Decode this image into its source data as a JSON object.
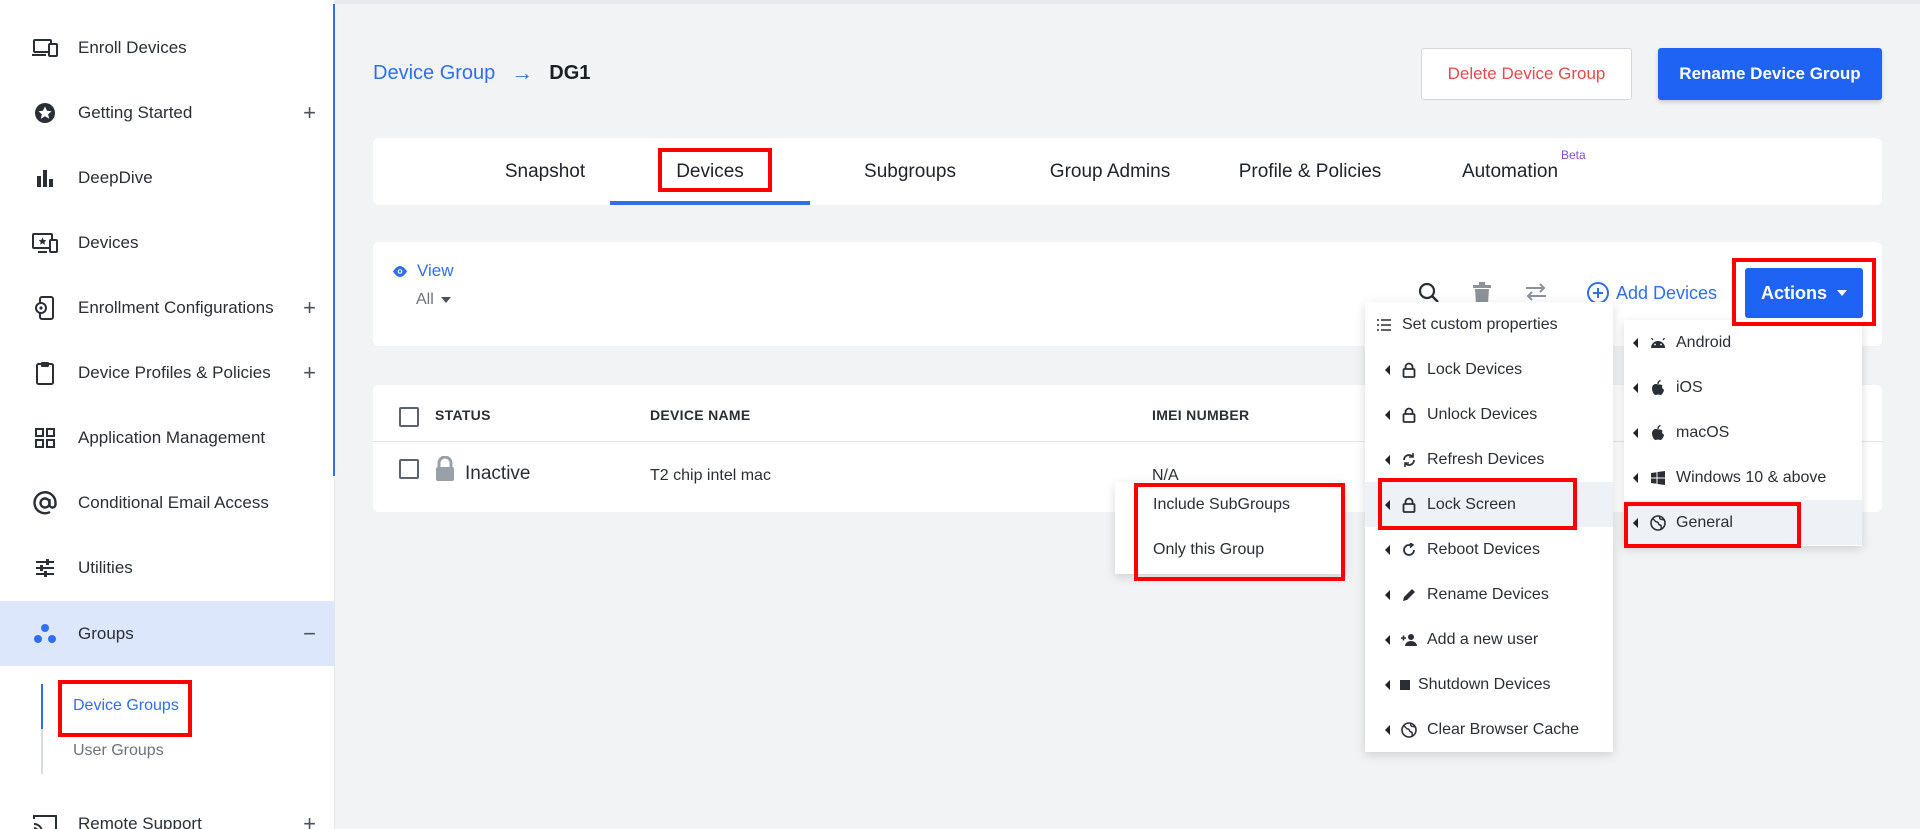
{
  "sidebar": {
    "items": [
      {
        "label": "Enroll Devices",
        "icon": "devices-icon",
        "plus": false
      },
      {
        "label": "Getting Started",
        "icon": "star-icon",
        "plus": true
      },
      {
        "label": "DeepDive",
        "icon": "bar-chart-icon",
        "plus": false
      },
      {
        "label": "Devices",
        "icon": "monitor-star-icon",
        "plus": false
      },
      {
        "label": "Enrollment Configurations",
        "icon": "phone-gear-icon",
        "plus": true
      },
      {
        "label": "Device Profiles & Policies",
        "icon": "clipboard-icon",
        "plus": true
      },
      {
        "label": "Application Management",
        "icon": "apps-grid-icon",
        "plus": false
      },
      {
        "label": "Conditional Email Access",
        "icon": "at-sign-icon",
        "plus": false
      },
      {
        "label": "Utilities",
        "icon": "sliders-icon",
        "plus": false
      },
      {
        "label": "Groups",
        "icon": "groups-icon",
        "minus": true
      },
      {
        "label": "Remote Support",
        "icon": "cast-icon",
        "plus": true
      }
    ],
    "sub_items": [
      "Device Groups",
      "User Groups"
    ],
    "plus_symbol": "+",
    "minus_symbol": "−"
  },
  "header": {
    "breadcrumb_root": "Device Group",
    "breadcrumb_arrow": "→",
    "breadcrumb_current": "DG1",
    "delete_label": "Delete Device Group",
    "rename_label": "Rename Device Group"
  },
  "tabs": {
    "items": [
      "Snapshot",
      "Devices",
      "Subgroups",
      "Group Admins",
      "Profile & Policies",
      "Automation"
    ],
    "active": "Devices",
    "beta_label": "Beta"
  },
  "toolbar": {
    "view_label": "View",
    "view_value": "All",
    "add_devices_label": "Add Devices",
    "actions_label": "Actions"
  },
  "table": {
    "columns": [
      "STATUS",
      "DEVICE NAME",
      "IMEI NUMBER"
    ],
    "rows": [
      {
        "status": "Inactive",
        "device_name": "T2 chip intel mac",
        "imei": "N/A"
      }
    ]
  },
  "actions_menu": {
    "items": [
      {
        "label": "Set custom properties",
        "icon": "list-icon",
        "sub": false
      },
      {
        "label": "Lock Devices",
        "icon": "lock-icon",
        "sub": true
      },
      {
        "label": "Unlock Devices",
        "icon": "lock-icon",
        "sub": true
      },
      {
        "label": "Refresh Devices",
        "icon": "refresh-icon",
        "sub": true
      },
      {
        "label": "Lock Screen",
        "icon": "lock-icon",
        "sub": true
      },
      {
        "label": "Reboot Devices",
        "icon": "reboot-icon",
        "sub": true
      },
      {
        "label": "Rename Devices",
        "icon": "pencil-icon",
        "sub": true
      },
      {
        "label": "Add a new user",
        "icon": "add-user-icon",
        "sub": true
      },
      {
        "label": "Shutdown Devices",
        "icon": "stop-icon",
        "sub": true
      },
      {
        "label": "Clear Browser Cache",
        "icon": "globe-icon",
        "sub": true
      }
    ]
  },
  "platform_menu": {
    "items": [
      {
        "label": "Android",
        "icon": "android-icon"
      },
      {
        "label": "iOS",
        "icon": "apple-icon"
      },
      {
        "label": "macOS",
        "icon": "apple-icon"
      },
      {
        "label": "Windows 10 & above",
        "icon": "windows-icon"
      },
      {
        "label": "General",
        "icon": "globe-icon"
      }
    ]
  },
  "scope_menu": {
    "items": [
      "Include SubGroups",
      "Only this Group"
    ]
  },
  "colors": {
    "primary": "#1f63f5",
    "danger": "#e24c4b",
    "highlight_box": "#ff0000",
    "active_nav_bg": "#dde7fb"
  }
}
